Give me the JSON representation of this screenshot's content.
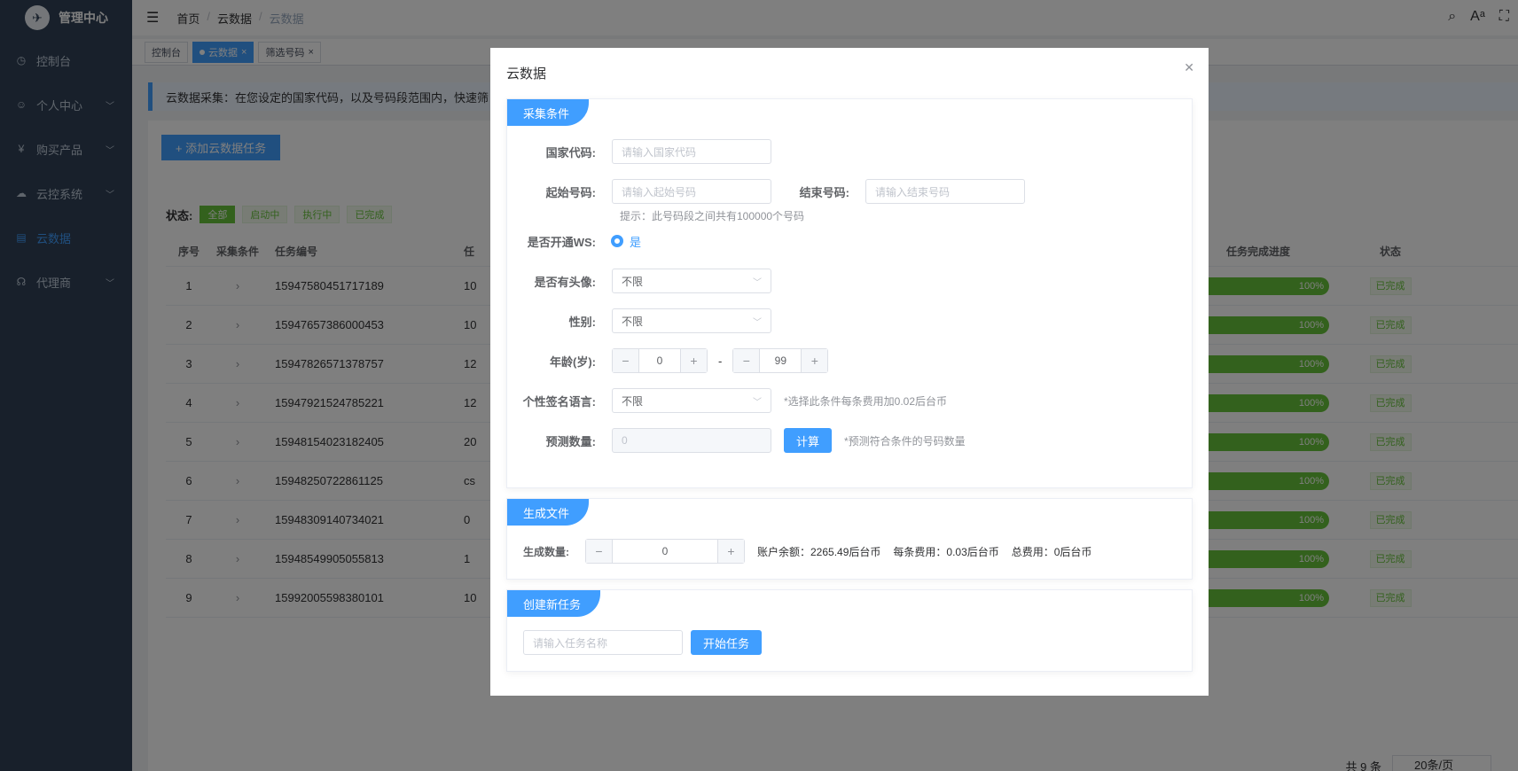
{
  "app": {
    "title": "管理中心"
  },
  "sidebar": {
    "items": [
      {
        "label": "控制台",
        "icon": "dashboard-icon",
        "glyph": "◷"
      },
      {
        "label": "个人中心",
        "icon": "user-icon",
        "glyph": "☺"
      },
      {
        "label": "购买产品",
        "icon": "yen-icon",
        "glyph": "¥"
      },
      {
        "label": "云控系统",
        "icon": "cloud-icon",
        "glyph": "☁"
      },
      {
        "label": "云数据",
        "icon": "document-icon",
        "glyph": "▤"
      },
      {
        "label": "代理商",
        "icon": "headset-icon",
        "glyph": "☊"
      }
    ]
  },
  "breadcrumb": {
    "home": "首页",
    "section": "云数据",
    "current": "云数据"
  },
  "tags": {
    "t1": "控制台",
    "t2": "云数据",
    "t3": "筛选号码"
  },
  "alert": {
    "text": "云数据采集：在您设定的国家代码，以及号码段范围内，快速筛"
  },
  "toolbar": {
    "add_label": "+ 添加云数据任务"
  },
  "status_filter": {
    "label": "状态:",
    "options": [
      "全部",
      "启动中",
      "执行中",
      "已完成"
    ]
  },
  "table": {
    "headers": {
      "index": "序号",
      "cond": "采集条件",
      "task_no": "任务编号",
      "col4": "任",
      "progress": "任务完成进度",
      "state": "状态"
    },
    "rows": [
      {
        "index": "1",
        "task_no": "15947580451717189",
        "col4": "10",
        "progress": 1.0,
        "progress_label": "100%",
        "state": "已完成"
      },
      {
        "index": "2",
        "task_no": "15947657386000453",
        "col4": "10",
        "progress": 1.0,
        "progress_label": "100%",
        "state": "已完成"
      },
      {
        "index": "3",
        "task_no": "15947826571378757",
        "col4": "12",
        "progress": 1.0,
        "progress_label": "100%",
        "state": "已完成"
      },
      {
        "index": "4",
        "task_no": "15947921524785221",
        "col4": "12",
        "progress": 1.0,
        "progress_label": "100%",
        "state": "已完成"
      },
      {
        "index": "5",
        "task_no": "15948154023182405",
        "col4": "20",
        "progress": 1.0,
        "progress_label": "100%",
        "state": "已完成"
      },
      {
        "index": "6",
        "task_no": "15948250722861125",
        "col4": "cs",
        "progress": 1.0,
        "progress_label": "100%",
        "state": "已完成"
      },
      {
        "index": "7",
        "task_no": "15948309140734021",
        "col4": "0",
        "progress": 1.0,
        "progress_label": "100%",
        "state": "已完成"
      },
      {
        "index": "8",
        "task_no": "15948549905055813",
        "col4": "1",
        "progress": 1.0,
        "progress_label": "100%",
        "state": "已完成"
      },
      {
        "index": "9",
        "task_no": "15992005598380101",
        "col4": "10",
        "progress": 1.0,
        "progress_label": "100%",
        "state": "已完成"
      }
    ]
  },
  "pagination": {
    "total": "共 9 条",
    "page_size": "20条/页"
  },
  "dialog": {
    "title": "云数据",
    "section1": {
      "title": "采集条件",
      "country_label": "国家代码:",
      "country_placeholder": "请输入国家代码",
      "start_label": "起始号码:",
      "start_placeholder": "请输入起始号码",
      "end_label": "结束号码:",
      "end_placeholder": "请输入结束号码",
      "range_hint": "提示：此号码段之间共有100000个号码",
      "ws_label": "是否开通WS:",
      "ws_option": "是",
      "avatar_label": "是否有头像:",
      "avatar_value": "不限",
      "gender_label": "性别:",
      "gender_value": "不限",
      "age_label": "年龄(岁):",
      "age_min": "0",
      "age_sep": "-",
      "age_max": "99",
      "lang_label": "个性签名语言:",
      "lang_value": "不限",
      "lang_hint": "*选择此条件每条费用加0.02后台币",
      "predict_label": "预测数量:",
      "predict_value": "0",
      "calc_button": "计算",
      "predict_hint": "*预测符合条件的号码数量"
    },
    "section2": {
      "title": "生成文件",
      "qty_label": "生成数量:",
      "qty_value": "0",
      "balance": "账户余额：2265.49后台币",
      "unit_cost": "每条费用：0.03后台币",
      "total_cost": "总费用：0后台币"
    },
    "section3": {
      "title": "创建新任务",
      "name_placeholder": "请输入任务名称",
      "start_button": "开始任务"
    }
  }
}
